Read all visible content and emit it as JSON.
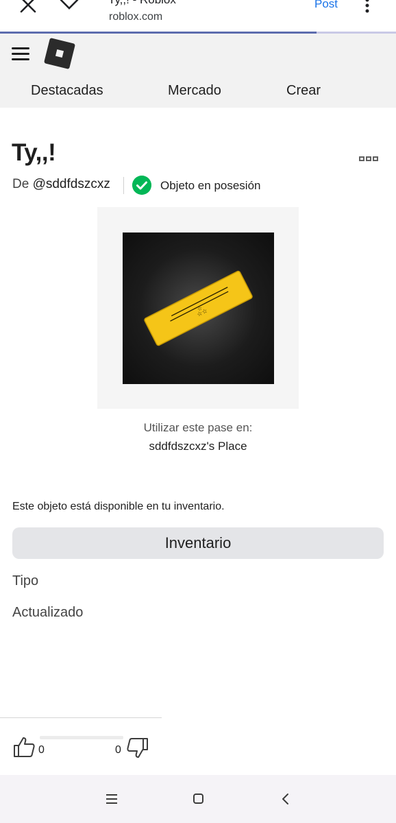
{
  "browser": {
    "tab_title": "Ty,,! - Roblox",
    "url": "roblox.com",
    "post_label": "Post",
    "load_progress": 0.8
  },
  "nav": {
    "featured": "Destacadas",
    "market": "Mercado",
    "create": "Crear"
  },
  "item": {
    "title": "Ty,,!",
    "by_prefix": "De",
    "creator": "@sddfdszcxz",
    "owned_label": "Objeto en posesión",
    "use_label": "Utilizar este pase en:",
    "place_name": "sddfdszcxz's Place",
    "availability": "Este objeto está disponible en tu inventario.",
    "inventory_button": "Inventario",
    "type_label": "Tipo",
    "updated_label": "Actualizado"
  },
  "votes": {
    "up": "0",
    "down": "0"
  },
  "colors": {
    "brand_dark": "#2b2b2b",
    "owned_green": "#02b757",
    "link_blue": "#1a73e8",
    "pass_gold": "#f5c518"
  },
  "icons": [
    "close-icon",
    "chevron-down-icon",
    "kebab-menu-icon",
    "hamburger-icon",
    "roblox-logo",
    "more-options-icon",
    "check-circle-icon",
    "thumbs-up-icon",
    "thumbs-down-icon",
    "recent-apps-icon",
    "home-icon",
    "back-icon"
  ]
}
